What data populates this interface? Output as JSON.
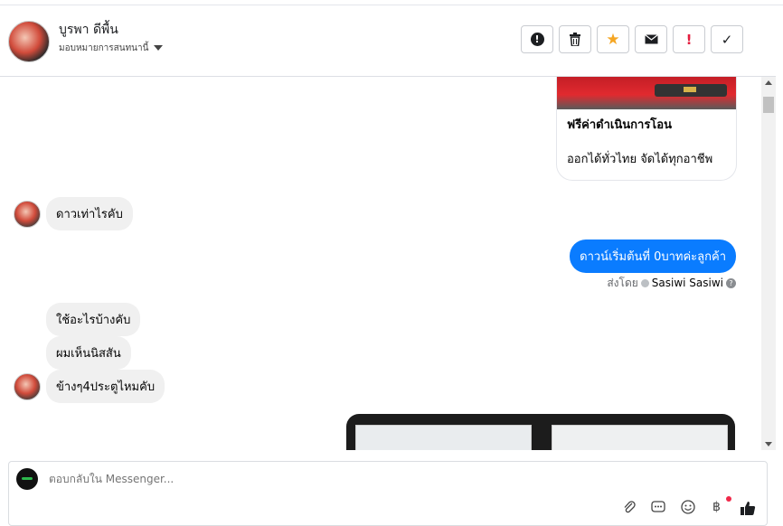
{
  "header": {
    "contact_name": "บูรพา ดีพื้น",
    "assign_label": "มอบหมายการสนทนานี้"
  },
  "actions": [
    {
      "name": "mark-spam",
      "glyph": "!"
    },
    {
      "name": "delete",
      "glyph": "🗑"
    },
    {
      "name": "star",
      "glyph": "★"
    },
    {
      "name": "mark-unread",
      "glyph": "✉"
    },
    {
      "name": "follow-up",
      "glyph": "!"
    },
    {
      "name": "mark-done",
      "glyph": "✓"
    }
  ],
  "card": {
    "title": "ฟรีค่าดำเนินการโอน",
    "subtitle": "ออกได้ทั่วไทย จัดได้ทุกอาชีพ"
  },
  "messages": {
    "m1": "ดาวเท่าไรคับ",
    "m2": "ดาวน์เริ่มต้นที่ 0บาทค่ะลูกค้า",
    "m3": "ใช้อะไรบ้างคับ",
    "m4": "ผมเห็นนิสสัน",
    "m5": "ข้างๆ4ประตูไหมคับ"
  },
  "sent_by": {
    "prefix": "ส่งโดย",
    "name": "Sasiwi Sasiwi",
    "help": "?"
  },
  "composer": {
    "placeholder": "ตอบกลับใน Messenger..."
  },
  "colors": {
    "accent": "#0a7cff",
    "star": "#f5a623",
    "alert": "#e41e3f"
  }
}
